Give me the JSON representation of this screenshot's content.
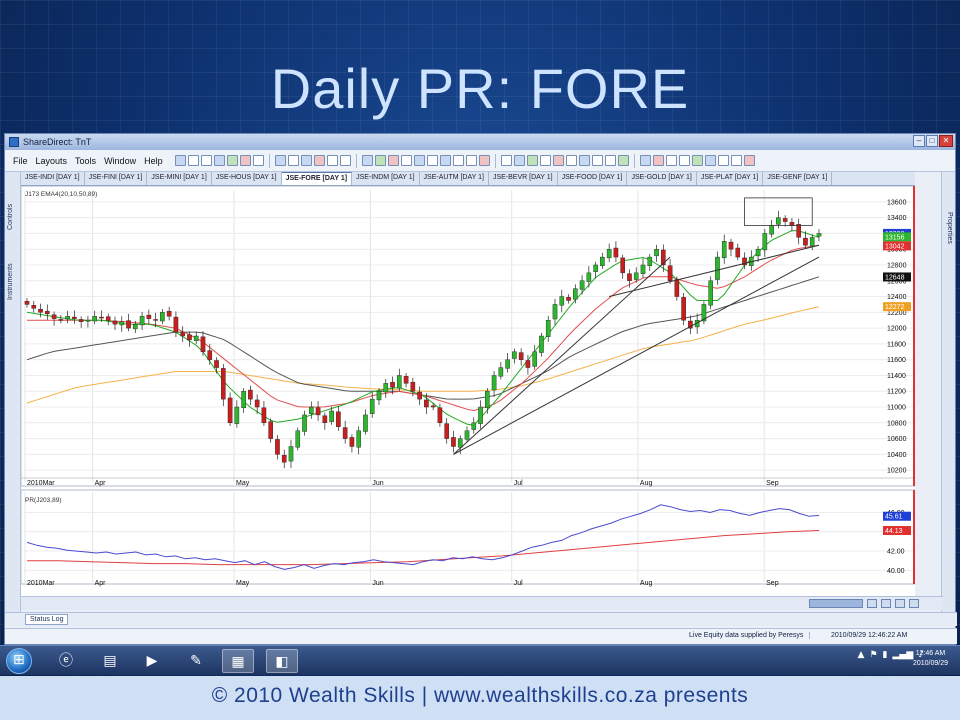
{
  "slide": {
    "title": "Daily PR: FORE",
    "footer": "© 2010 Wealth Skills | www.wealthskills.co.za presents"
  },
  "window": {
    "title": "ShareDirect: TnT",
    "controls": [
      "–",
      "□",
      "✕"
    ]
  },
  "menu": {
    "items": [
      {
        "label": "File",
        "underline": "F"
      },
      {
        "label": "Layouts",
        "underline": "L"
      },
      {
        "label": "Tools",
        "underline": "T"
      },
      {
        "label": "Window",
        "underline": "W"
      },
      {
        "label": "Help",
        "underline": "H"
      }
    ]
  },
  "left_panel": {
    "tabs": [
      "Controls",
      "Instruments"
    ]
  },
  "right_panel": {
    "tabs": [
      "Properties"
    ]
  },
  "tabs": [
    "JSE-INDI [DAY 1]",
    "JSE-FINI [DAY 1]",
    "JSE-MINI [DAY 1]",
    "JSE-HOUS [DAY 1]",
    "JSE-FORE [DAY 1]",
    "JSE-INDM [DAY 1]",
    "JSE-AUTM [DAY 1]",
    "JSE-BEVR [DAY 1]",
    "JSE-FOOD [DAY 1]",
    "JSE-GOLD [DAY 1]",
    "JSE-PLAT [DAY 1]",
    "JSE-GENF [DAY 1]"
  ],
  "active_tab_index": 4,
  "status_log": {
    "label": "Status Log"
  },
  "status_bar": {
    "message": "Live Equity data supplied by Peresys",
    "timestamp": "2010/09/29 12:46:22 AM"
  },
  "taskbar": {
    "clock_time": "12:46 AM",
    "clock_date": "2010/09/29"
  },
  "colors": {
    "up_candle": "#2db52d",
    "down_candle": "#c81e1e",
    "ema_fast": "#22aa22",
    "ema_mid": "#e05050",
    "ema_slow": "#555555",
    "ema_long": "#f4b24a",
    "pr_line": "#4a4ad0",
    "pr_signal": "#e04040",
    "axis_border": "#e03030"
  },
  "chart_data": [
    {
      "type": "candlestick",
      "title": "J173 EMA4(20,10,50,89)",
      "x_labels": [
        "2010Mar",
        "Apr",
        "May",
        "Jun",
        "Jul",
        "Aug",
        "Sep"
      ],
      "y_ticks": [
        10200,
        10400,
        10600,
        10800,
        11000,
        11200,
        11400,
        11600,
        11800,
        12000,
        12200,
        12400,
        12600,
        12800,
        13000,
        13200,
        13400,
        13600
      ],
      "ylim": [
        10050,
        13750
      ],
      "price_flags": [
        {
          "value": 13200,
          "text": "13200",
          "color": "#1f3fd6"
        },
        {
          "value": 13156,
          "text": "13156",
          "color": "#2db52d"
        },
        {
          "value": 13042,
          "text": "13042",
          "color": "#e03030"
        },
        {
          "value": 12648,
          "text": "12648",
          "color": "#111111"
        },
        {
          "value": 12272,
          "text": "12272",
          "color": "#f0a020"
        }
      ],
      "closes": [
        12300,
        12250,
        12200,
        12180,
        12120,
        12100,
        12150,
        12120,
        12080,
        12100,
        12150,
        12130,
        12100,
        12050,
        12080,
        12000,
        12050,
        12150,
        12120,
        12100,
        12200,
        12150,
        11950,
        11900,
        11850,
        11900,
        11700,
        11600,
        11500,
        11100,
        10800,
        11000,
        11200,
        11100,
        11000,
        10800,
        10600,
        10400,
        10300,
        10500,
        10700,
        10900,
        11000,
        10900,
        10800,
        10950,
        10750,
        10600,
        10500,
        10700,
        10900,
        11100,
        11200,
        11300,
        11250,
        11400,
        11300,
        11200,
        11100,
        11000,
        11000,
        10800,
        10600,
        10500,
        10600,
        10700,
        10800,
        11000,
        11200,
        11400,
        11500,
        11600,
        11700,
        11600,
        11500,
        11700,
        11900,
        12100,
        12300,
        12400,
        12350,
        12500,
        12600,
        12700,
        12800,
        12900,
        13000,
        12900,
        12700,
        12600,
        12700,
        12800,
        12900,
        13000,
        12800,
        12600,
        12400,
        12100,
        12000,
        12100,
        12300,
        12600,
        12900,
        13100,
        13000,
        12900,
        12800,
        12900,
        13000,
        13200,
        13300,
        13400,
        13350,
        13300,
        13150,
        13050,
        13150,
        13200
      ],
      "ema_fast_anchor": [
        12200,
        12150,
        12100,
        12100,
        12050,
        12050,
        11950,
        11750,
        11300,
        11000,
        10800,
        10850,
        10950,
        11050,
        11200,
        11250,
        11150,
        10900,
        10750,
        11100,
        11500,
        11900,
        12300,
        12650,
        12850,
        12900,
        12700,
        12350,
        12350,
        12800,
        13100,
        13250,
        13150
      ],
      "ema_mid_anchor": [
        12100,
        12100,
        12100,
        12100,
        12080,
        12050,
        12000,
        11850,
        11600,
        11350,
        11100,
        11000,
        11000,
        11050,
        11150,
        11200,
        11150,
        11050,
        10950,
        11050,
        11300,
        11600,
        11950,
        12250,
        12500,
        12650,
        12650,
        12550,
        12500,
        12650,
        12850,
        13000,
        13050
      ],
      "ema_slow_anchor": [
        11600,
        11700,
        11750,
        11800,
        11850,
        11900,
        11950,
        11950,
        11850,
        11650,
        11450,
        11300,
        11250,
        11200,
        11200,
        11200,
        11150,
        11100,
        11100,
        11150,
        11300,
        11450,
        11650,
        11800,
        11950,
        12050,
        12100,
        12150,
        12250,
        12350,
        12450,
        12550,
        12650
      ],
      "ema_long_anchor": [
        11050,
        11150,
        11250,
        11300,
        11350,
        11400,
        11450,
        11450,
        11450,
        11400,
        11350,
        11300,
        11280,
        11250,
        11230,
        11220,
        11200,
        11200,
        11200,
        11220,
        11270,
        11350,
        11450,
        11550,
        11650,
        11750,
        11800,
        11850,
        11950,
        12050,
        12120,
        12200,
        12270
      ],
      "trendlines": [
        {
          "from_index": 63,
          "from_value": 10400,
          "to_index": 117,
          "to_value": 12900
        },
        {
          "from_index": 63,
          "from_value": 10400,
          "to_index": 95,
          "to_value": 12900
        },
        {
          "from_index": 86,
          "from_value": 12400,
          "to_index": 117,
          "to_value": 13050
        }
      ]
    },
    {
      "type": "line",
      "title": "PR(J203,89)",
      "x_labels": [
        "2010Mar",
        "Apr",
        "May",
        "Jun",
        "Jul",
        "Aug",
        "Sep"
      ],
      "y_ticks": [
        40.0,
        42.0,
        44.0,
        46.0
      ],
      "ylim": [
        39.0,
        47.5
      ],
      "value_flags": [
        {
          "value": 45.61,
          "text": "45.61",
          "color": "#1f3fd6"
        },
        {
          "value": 44.13,
          "text": "44.13",
          "color": "#e03030"
        }
      ],
      "series": [
        {
          "values": [
            42.9,
            42.6,
            42.4,
            42.3,
            42.1,
            42.0,
            41.9,
            41.8,
            41.9,
            41.7,
            41.8,
            41.9,
            41.6,
            41.7,
            41.4,
            41.5,
            41.2,
            41.3,
            41.1,
            41.2,
            41.0,
            40.8,
            41.0,
            40.6,
            40.9,
            40.4,
            40.1,
            40.3,
            40.6,
            40.2,
            40.5,
            40.7,
            40.6,
            40.8,
            40.9,
            41.1,
            40.9,
            40.8,
            40.7,
            40.6,
            40.9,
            41.1,
            41.0,
            41.3,
            41.2,
            41.4,
            41.2,
            41.1,
            41.3,
            41.6,
            42.0,
            42.4,
            42.6,
            42.9,
            43.1,
            43.6,
            43.9,
            44.3,
            44.6,
            44.9,
            45.3,
            45.6,
            45.9,
            46.3,
            46.8,
            46.6,
            46.3,
            46.1,
            46.2,
            46.0,
            46.3,
            46.2,
            45.9,
            45.7,
            46.0,
            46.2,
            46.4,
            46.3,
            45.9,
            45.6,
            45.7
          ]
        },
        {
          "values": [
            41.0,
            41.0,
            40.9,
            40.8,
            40.7,
            40.7,
            40.6,
            40.6,
            40.6,
            40.6,
            40.7,
            40.8,
            40.9,
            41.1,
            41.3,
            41.5,
            41.8,
            42.1,
            42.4,
            42.7,
            43.0,
            43.3,
            43.6,
            43.8,
            44.0,
            44.13
          ]
        }
      ]
    }
  ]
}
